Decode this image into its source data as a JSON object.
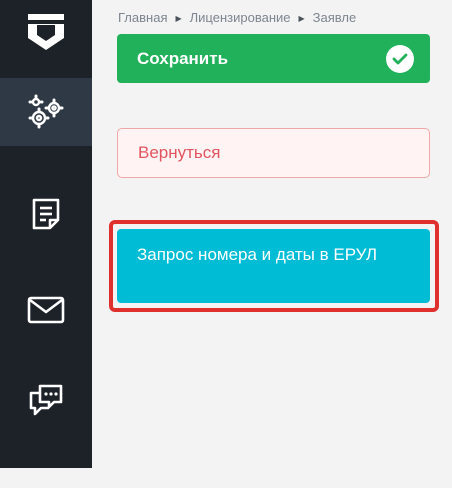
{
  "sidebar": {
    "items": [
      {
        "icon": "settings-gears-icon",
        "active": true
      },
      {
        "icon": "document-icon",
        "active": false
      },
      {
        "icon": "mail-icon",
        "active": false
      },
      {
        "icon": "chat-icon",
        "active": false
      }
    ]
  },
  "breadcrumb": {
    "items": [
      "Главная",
      "Лицензирование",
      "Заявле"
    ],
    "separator": "▶"
  },
  "actions": {
    "save_label": "Сохранить",
    "back_label": "Вернуться",
    "erul_label": "Запрос номера и даты в ЕРУЛ"
  },
  "colors": {
    "sidebar_bg": "#1c2228",
    "sidebar_active": "#2f3946",
    "save_green": "#21b15a",
    "back_text": "#e2555f",
    "erul_cyan": "#00bcd4",
    "highlight_red": "#e0302e"
  }
}
